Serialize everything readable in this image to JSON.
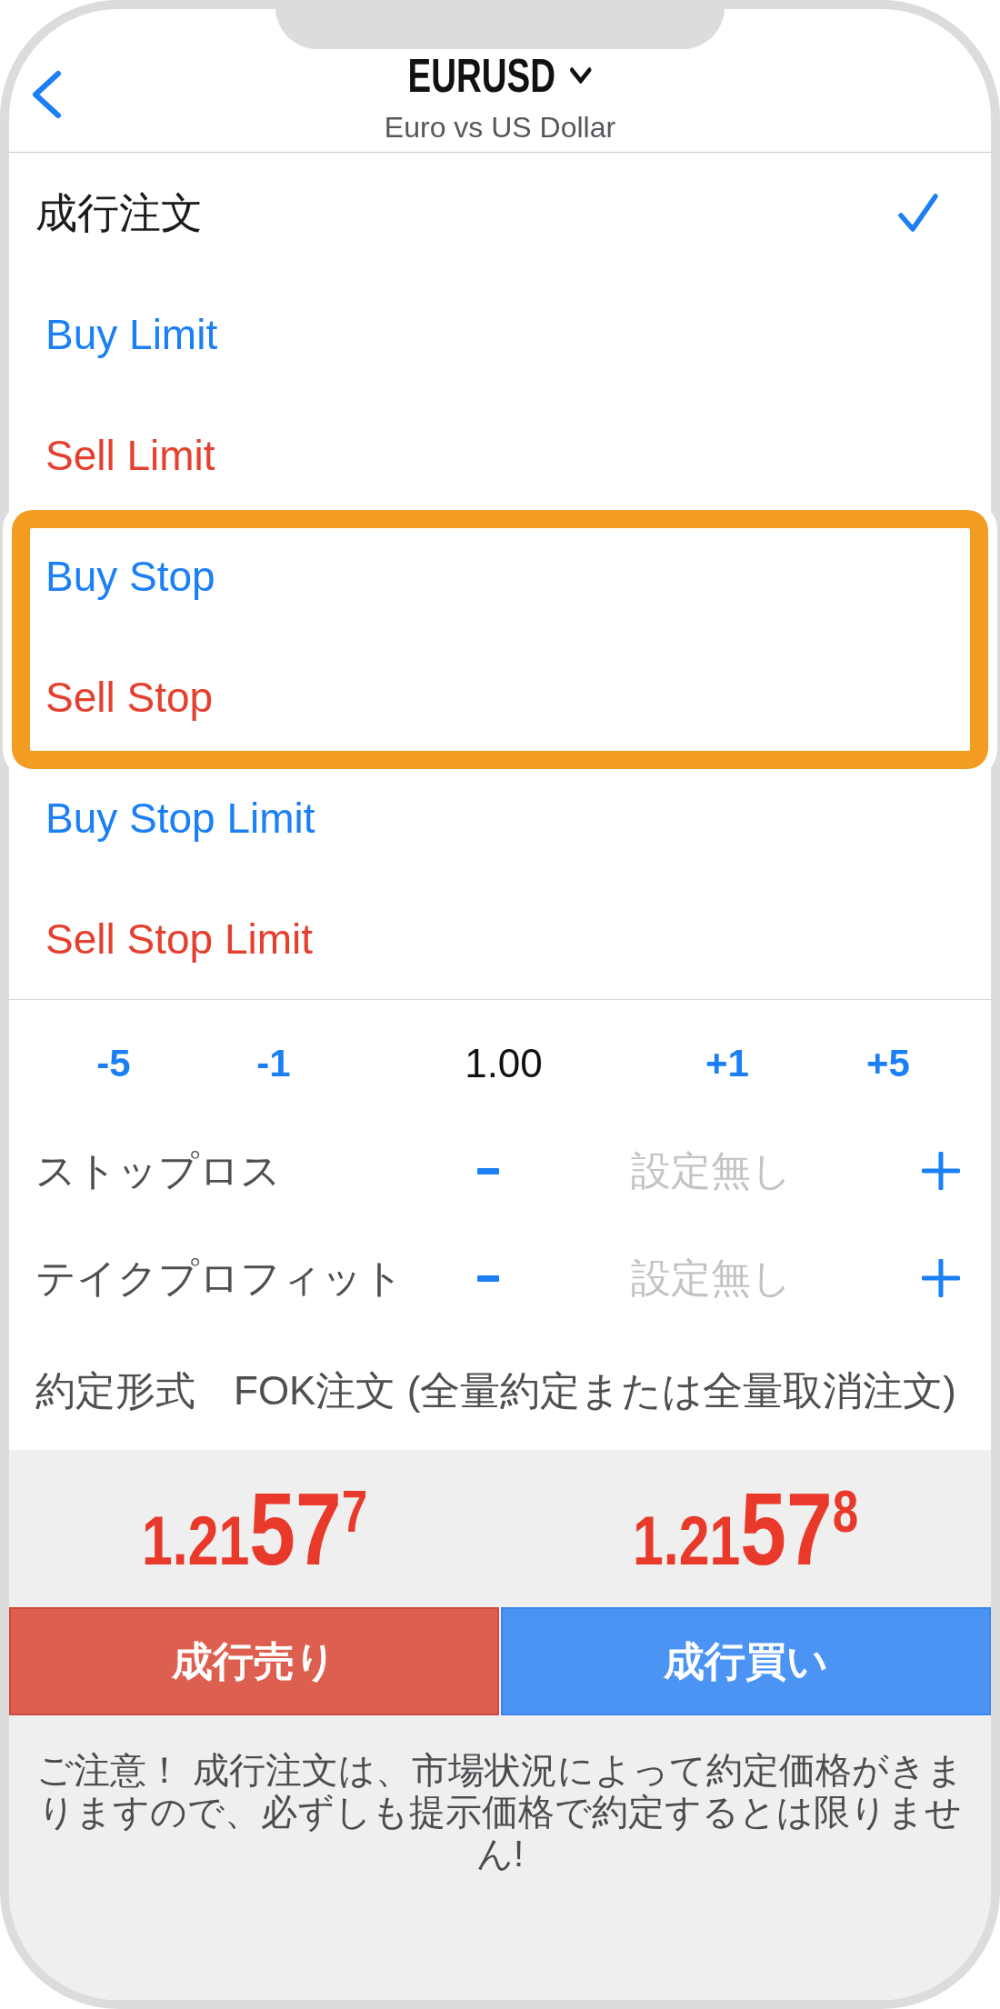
{
  "header": {
    "symbol": "EURUSD",
    "description": "Euro vs US Dollar"
  },
  "order_types": [
    {
      "label": "成行注文",
      "kind": "market",
      "selected": true,
      "highlighted": false
    },
    {
      "label": "Buy Limit",
      "kind": "buy",
      "selected": false,
      "highlighted": false
    },
    {
      "label": "Sell Limit",
      "kind": "sell",
      "selected": false,
      "highlighted": false
    },
    {
      "label": "Buy Stop",
      "kind": "buy",
      "selected": false,
      "highlighted": true
    },
    {
      "label": "Sell Stop",
      "kind": "sell",
      "selected": false,
      "highlighted": true
    },
    {
      "label": "Buy Stop Limit",
      "kind": "buy",
      "selected": false,
      "highlighted": false
    },
    {
      "label": "Sell Stop Limit",
      "kind": "sell",
      "selected": false,
      "highlighted": false
    }
  ],
  "volume": {
    "decrease": [
      "-5",
      "-1"
    ],
    "value": "1.00",
    "increase": [
      "+1",
      "+5"
    ]
  },
  "levels": [
    {
      "label": "ストップロス",
      "placeholder": "設定無し"
    },
    {
      "label": "テイクプロフィット",
      "placeholder": "設定無し"
    }
  ],
  "fill_policy": {
    "label": "約定形式",
    "value": "FOK注文 (全量約定または全量取消注文)"
  },
  "sides": [
    {
      "kind": "sell",
      "price": "1.21**57**$^{7}$",
      "falling": true,
      "button": "成行売り"
    },
    {
      "kind": "buy",
      "price": "1.21**57**$^{8}$",
      "falling": true,
      "button": "成行買い"
    }
  ],
  "notice": "ご注意！ 成行注文は、市場状況によって約定価格がきまりますので、必ずしも提示価格で約定するとは限りません!"
}
